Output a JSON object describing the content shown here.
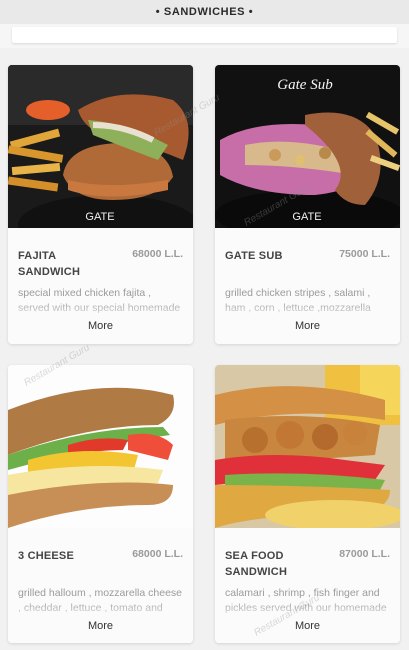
{
  "header": {
    "title": "• SANDWICHES •"
  },
  "watermark": "Restaurant Guru",
  "cards": [
    {
      "name": "FAJITA\nSANDWICH",
      "price": "68000 L.L.",
      "description": "special mixed chicken fajita , served with our special homemade chipotle sauce",
      "more": "More"
    },
    {
      "name": "GATE SUB",
      "price": "75000 L.L.",
      "description": "grilled chicken stripes , salami , ham , corn , lettuce ,mozzarella cheese served with tartar sauce",
      "more": "More",
      "photo_title": "Gate Sub"
    },
    {
      "name": "3 CHEESE",
      "price": "68000 L.L.",
      "description": "grilled halloum , mozzarella cheese , cheddar , lettuce , tomato and cucumber",
      "more": "More"
    },
    {
      "name": "SEA FOOD\nSANDWICH",
      "price": "87000 L.L.",
      "description": "calamari , shrimp , fish finger and pickles served with our homemade sauce",
      "more": "More"
    }
  ],
  "brand": {
    "logo": "GATE"
  }
}
